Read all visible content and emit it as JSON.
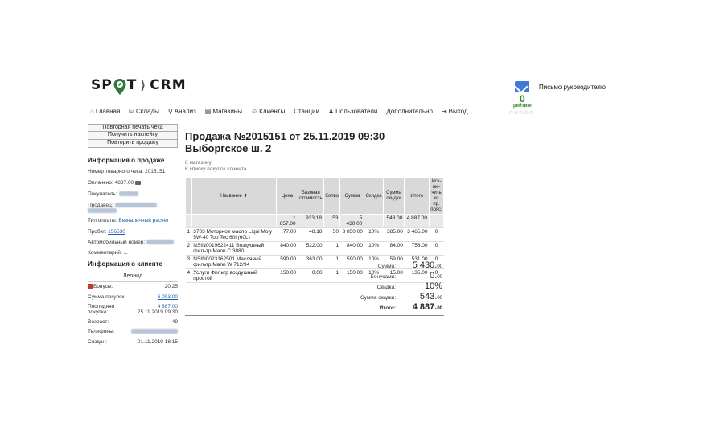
{
  "logo": {
    "left": "SP",
    "right": "T",
    "arrow": "⟩",
    "brand": "CRM"
  },
  "header": {
    "letter_link": "Письмо руководителю",
    "rating_value": "0",
    "rating_label": "рейтинг",
    "stars": "☆☆☆☆☆"
  },
  "nav": [
    {
      "icon": "⌂",
      "label": "Главная"
    },
    {
      "icon": "⛁",
      "label": "Склады"
    },
    {
      "icon": "⚲",
      "label": "Анализ"
    },
    {
      "icon": "▤",
      "label": "Магазины"
    },
    {
      "icon": "☺",
      "label": "Клиенты"
    },
    {
      "icon": "",
      "label": "Станции"
    },
    {
      "icon": "♟",
      "label": "Пользователи"
    },
    {
      "icon": "",
      "label": "Дополнительно"
    },
    {
      "icon": "⇥",
      "label": "Выход"
    }
  ],
  "sidebar": {
    "buttons": [
      "Повторная печать чека",
      "Получить наклейку",
      "Повторить продажу"
    ],
    "sale_info_title": "Информация о продаже",
    "receipt_label": "Номер товарного чека:",
    "receipt_value": "2015151",
    "paid_label": "Оплачено:",
    "paid_value": "4887.00",
    "buyer_label": "Покупатель:",
    "seller_label": "Продавец:",
    "payment_type_label": "Тип оплаты:",
    "payment_type_value": "Безналичный расчет",
    "mileage_label": "Пробег:",
    "mileage_value": "156530",
    "car_label": "Автомобильный номер:",
    "comment_label": "Комментарий:",
    "comment_value": "...",
    "client_info_title": "Информация о клиенте",
    "client_name": "Леонид",
    "client": {
      "bonus_label": "Бонусы:",
      "bonus_value": "20.25",
      "purchase_sum_label": "Сумма покупок:",
      "purchase_sum_value": "6 093.00",
      "last_purchase_label": "Последняя покупка:",
      "last_purchase_value": "4 887.00",
      "last_purchase_date": "25.11.2019 09:30",
      "age_label": "Возраст:",
      "age_value": "49",
      "phones_label": "Телефоны:",
      "created_label": "Создан:",
      "created_value": "01.11.2019 18:15"
    }
  },
  "main": {
    "title_line1": "Продажа №2015151 от 25.11.2019 09:30",
    "title_line2": "Выборгское ш. 2",
    "back_to_store": "К магазину",
    "back_to_list": "К списку покупок клиента"
  },
  "table": {
    "headers": [
      "Название ⬆",
      "Цена",
      "Базовая стоимость",
      "Колво",
      "Сумма",
      "Скидка",
      "Сумма скидки",
      "Итого",
      "Иск­лю­чить из пр. пояс."
    ],
    "sum_row": [
      "1 657.00",
      "933.18",
      "53",
      "5 430.00",
      "",
      "543.00",
      "4 887.00",
      ""
    ],
    "rows": [
      {
        "n": "1",
        "name": "3703 Моторное масло Liqui Moly 5W-40 Top Tec 60l (60L)",
        "price": "77.00",
        "base": "48.18",
        "qty": "50",
        "sum": "3 850.00",
        "disc": "10%",
        "disc_sum": "385.00",
        "total": "3 465.00",
        "excl": "0"
      },
      {
        "n": "2",
        "name": "NSIN0019622411 Воздушный фильтр Mann C 3880",
        "price": "840.00",
        "base": "522.00",
        "qty": "1",
        "sum": "840.00",
        "disc": "10%",
        "disc_sum": "84.00",
        "total": "756.00",
        "excl": "0"
      },
      {
        "n": "3",
        "name": "NSIN0023162501 Масляный фильтр Mann W 712/94",
        "price": "590.00",
        "base": "363.00",
        "qty": "1",
        "sum": "590.00",
        "disc": "10%",
        "disc_sum": "59.00",
        "total": "531.00",
        "excl": "0"
      },
      {
        "n": "4",
        "name": "Услуги Фильтр воздушный простой",
        "price": "150.00",
        "base": "0.00",
        "qty": "1",
        "sum": "150.00",
        "disc": "10%",
        "disc_sum": "15.00",
        "total": "135.00",
        "excl": "0"
      }
    ]
  },
  "totals": [
    {
      "label": "Сумма:",
      "value": "5 430.",
      "cents": "00"
    },
    {
      "label": "Бонусами:",
      "value": "0.",
      "cents": "00"
    },
    {
      "label": "Скидка:",
      "value": "10%",
      "cents": ""
    },
    {
      "label": "Сумма скидки:",
      "value": "543.",
      "cents": "00"
    },
    {
      "label": "Итого:",
      "value": "4 887.",
      "cents": "00"
    }
  ]
}
